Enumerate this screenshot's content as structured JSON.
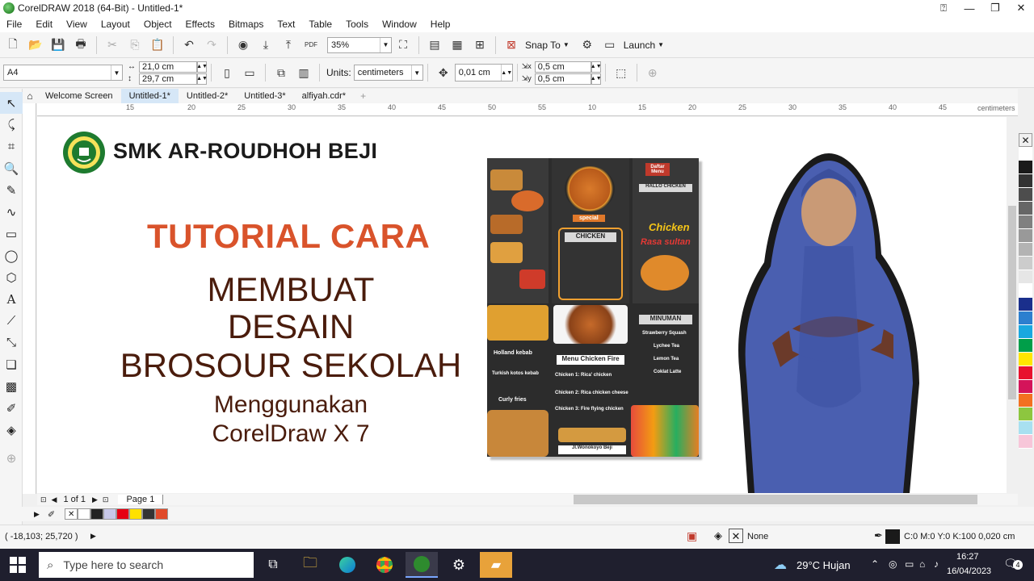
{
  "window": {
    "title": "CorelDRAW 2018 (64-Bit) - Untitled-1*"
  },
  "menu": [
    "File",
    "Edit",
    "View",
    "Layout",
    "Object",
    "Effects",
    "Bitmaps",
    "Text",
    "Table",
    "Tools",
    "Window",
    "Help"
  ],
  "toolbar1": {
    "zoom": "35%",
    "snap_label": "Snap To",
    "launch_label": "Launch"
  },
  "toolbar2": {
    "page_size": "A4",
    "width": "21,0 cm",
    "height": "29,7 cm",
    "units_label": "Units:",
    "units_value": "centimeters",
    "nudge": "0,01 cm",
    "dup_x": "0,5 cm",
    "dup_y": "0,5 cm"
  },
  "tabs": [
    "Welcome Screen",
    "Untitled-1*",
    "Untitled-2*",
    "Untitled-3*",
    "alfiyah.cdr*"
  ],
  "ruler": {
    "ticks": [
      "15",
      "20",
      "25",
      "30",
      "35",
      "40",
      "45",
      "50",
      "55",
      "60",
      "65",
      "10",
      "15",
      "20",
      "25",
      "30",
      "35",
      "40",
      "45"
    ],
    "unit": "centimeters"
  },
  "canvas": {
    "school_name": "SMK AR-ROUDHOH BEJI",
    "line1": "TUTORIAL CARA",
    "line2": "MEMBUAT",
    "line3": "DESAIN",
    "line4": "BROSOUR SEKOLAH",
    "line5": "Menggunakan",
    "line6": "CorelDraw X 7"
  },
  "brochure": {
    "top_label": "Daftar Menu",
    "hello": "HALLO CHICKEN",
    "brand": "Chicken",
    "brand_sub": "Rasa sultan",
    "special": "special",
    "chicken_header": "CHICKEN",
    "minuman": "MINUMAN",
    "menu_fire": "Menu Chicken Fire",
    "chicken1": "Chicken 1: Rica' chicken",
    "chicken2": "Chicken 2: Rica chicken cheese",
    "chicken3": "Chicken 3: Fire flying chicken",
    "holland": "Holland kebab",
    "turkish": "Turkish kotos kebab",
    "curly": "Curly fries",
    "address": "Jl.Wonokoyo Beji",
    "drink1": "Strawberry Squash",
    "drink2": "Lychee Tea",
    "drink3": "Lemon Tea",
    "drink4": "Coklat Latte"
  },
  "pagenav": {
    "page_count": "1 of 1",
    "page_tab": "Page 1"
  },
  "status": {
    "coords": "( -18,103; 25,720 )",
    "fill_none": "None",
    "outline": "C:0 M:0 Y:0 K:100  0,020 cm"
  },
  "taskbar": {
    "search_placeholder": "Type here to search",
    "weather": "29°C  Hujan",
    "time": "16:27",
    "date": "16/04/2023",
    "notif_count": "4"
  },
  "colors": {
    "accent_red": "#d9532b",
    "dark_brown": "#4a1c0c",
    "hijab_blue": "#4a5fb0"
  },
  "palette": [
    "#ffffff",
    "#1a1a1a",
    "#333333",
    "#4d4d4d",
    "#666666",
    "#808080",
    "#999999",
    "#b3b3b3",
    "#cccccc",
    "#e6e6e6",
    "#ffffff",
    "#1a2f8c",
    "#2c7fcf",
    "#19a8e0",
    "#009e49",
    "#ffe600",
    "#e8112d",
    "#d4145a",
    "#f37021",
    "#8dc63f",
    "#a8e0f0",
    "#f7c6d9"
  ],
  "docpalette": [
    "#ffffff",
    "#222222",
    "#c8c8e8",
    "#e60012",
    "#ffe100",
    "#333333",
    "#e04a2a"
  ]
}
